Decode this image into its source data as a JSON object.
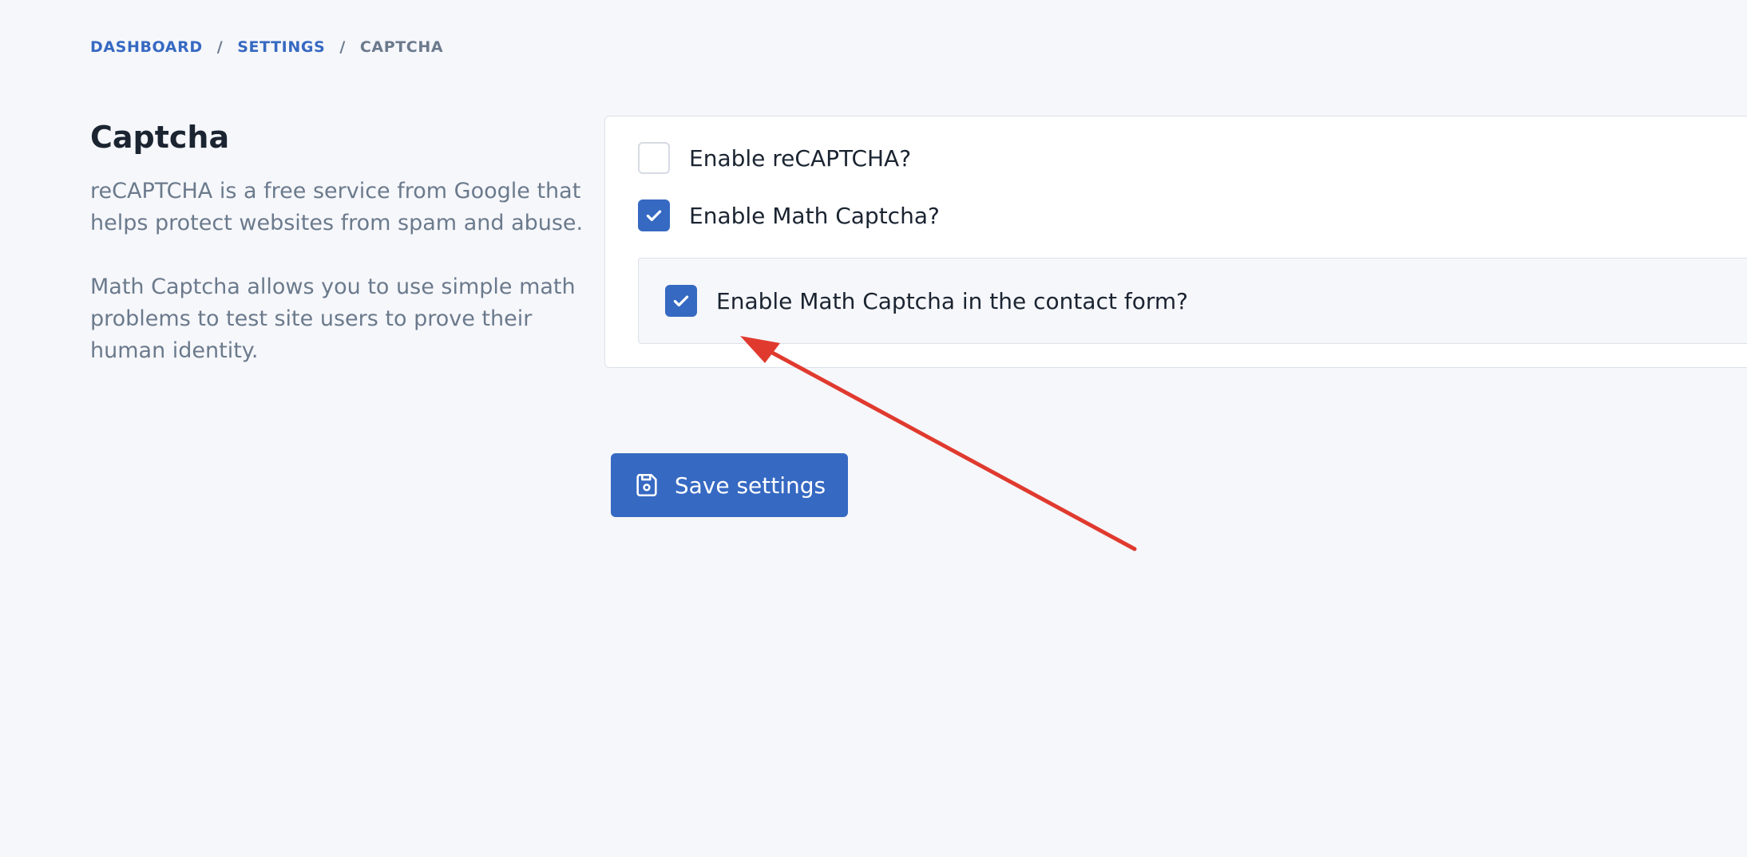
{
  "breadcrumb": {
    "items": [
      "DASHBOARD",
      "SETTINGS"
    ],
    "current": "CAPTCHA",
    "separator": "/"
  },
  "section": {
    "title": "Captcha",
    "description_1": "reCAPTCHA is a free service from Google that helps protect websites from spam and abuse.",
    "description_2": "Math Captcha allows you to use simple math problems to test site users to prove their human identity."
  },
  "options": {
    "recaptcha": {
      "label": "Enable reCAPTCHA?",
      "checked": false
    },
    "math_captcha": {
      "label": "Enable Math Captcha?",
      "checked": true
    },
    "math_captcha_contact": {
      "label": "Enable Math Captcha in the contact form?",
      "checked": true
    }
  },
  "actions": {
    "save_label": "Save settings",
    "save_icon": "save-icon"
  },
  "colors": {
    "accent": "#3669c2",
    "background": "#f6f7fb",
    "muted_text": "#6b7a8c",
    "annotation": "#e03a2f"
  }
}
